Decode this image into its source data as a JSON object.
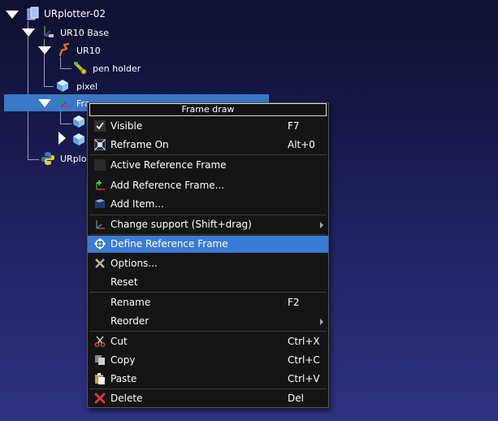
{
  "tree": {
    "station": "URplotter-02",
    "base": "UR10 Base",
    "robot": "UR10",
    "tool": "pen holder",
    "object": "pixel",
    "selected_frame": "Fra...",
    "program": "URplo..."
  },
  "menu": {
    "title": "Frame draw",
    "items": [
      {
        "label": "Visible",
        "shortcut": "F7",
        "icon": "check-icon"
      },
      {
        "label": "Reframe On",
        "shortcut": "Alt+0",
        "icon": "reframe-icon"
      },
      {
        "label": "Active Reference Frame",
        "shortcut": "",
        "icon": "checkbox-icon"
      },
      {
        "label": "Add Reference Frame...",
        "shortcut": "",
        "icon": "add-frame-icon"
      },
      {
        "label": "Add Item...",
        "shortcut": "",
        "icon": "add-item-icon"
      },
      {
        "label": "Change support (Shift+drag)",
        "shortcut": "",
        "icon": "axes-icon"
      },
      {
        "label": "Define Reference Frame",
        "shortcut": "",
        "icon": "target-icon"
      },
      {
        "label": "Options...",
        "shortcut": "",
        "icon": "tools-icon"
      },
      {
        "label": "Reset",
        "shortcut": "",
        "icon": ""
      },
      {
        "label": "Rename",
        "shortcut": "F2",
        "icon": ""
      },
      {
        "label": "Reorder",
        "shortcut": "",
        "icon": ""
      },
      {
        "label": "Cut",
        "shortcut": "Ctrl+X",
        "icon": "scissors-icon"
      },
      {
        "label": "Copy",
        "shortcut": "Ctrl+C",
        "icon": "copy-icon"
      },
      {
        "label": "Paste",
        "shortcut": "Ctrl+V",
        "icon": "paste-icon"
      },
      {
        "label": "Delete",
        "shortcut": "Del",
        "icon": "delete-icon"
      }
    ]
  },
  "colors": {
    "highlight": "#3a7bd5",
    "selection": "#3a78c8",
    "menu_bg": "#141414"
  }
}
